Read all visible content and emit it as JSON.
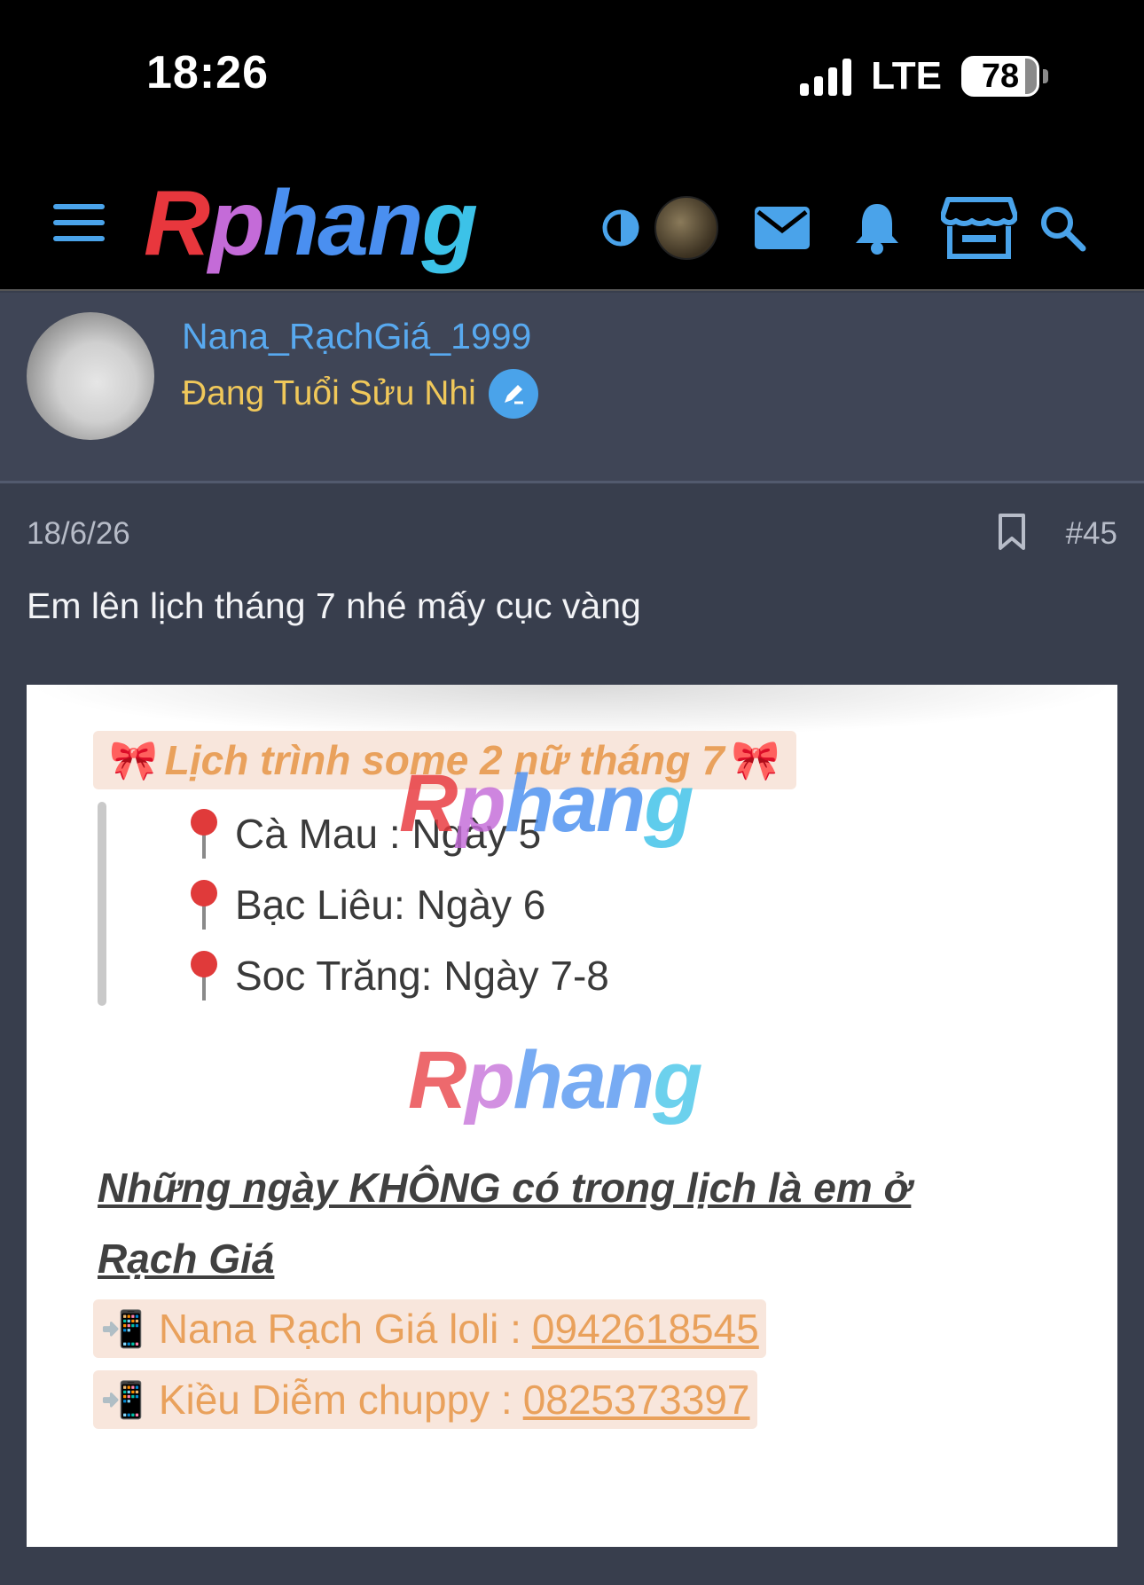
{
  "status_bar": {
    "time": "18:26",
    "network": "LTE",
    "battery": "78"
  },
  "nav": {
    "logo": {
      "a": "R",
      "b": "p",
      "c": "han",
      "d": "g"
    },
    "icons": [
      "menu-icon",
      "contrast-icon",
      "avatar",
      "mail-icon",
      "bell-icon",
      "store-icon",
      "search-icon"
    ]
  },
  "user": {
    "name": "Nana_RạchGiá_1999",
    "title": "Đang Tuổi Sửu Nhi"
  },
  "post": {
    "date": "18/6/26",
    "number": "#45",
    "text": "Em lên lịch tháng 7 nhé mấy cục vàng"
  },
  "image": {
    "title": "Lịch trình some 2 nữ tháng 7",
    "watermark": {
      "a": "R",
      "b": "p",
      "c": "han",
      "d": "g"
    },
    "locations": [
      "Cà Mau : Ngày 5",
      " Bạc Liêu: Ngày 6",
      "Soc Trăng: Ngày 7-8"
    ],
    "notice_line1": "Những ngày KHÔNG có trong lịch là em ở",
    "notice_line2": "Rạch Giá",
    "contacts": [
      {
        "label": "Nana Rạch Giá loli :",
        "number": "0942618545"
      },
      {
        "label": "Kiều Diễm chuppy :",
        "number": "0825373397"
      }
    ]
  },
  "colors": {
    "accent": "#4aa3ea",
    "username": "#58a9ef",
    "title": "#f0c85a",
    "background": "#383e4d"
  }
}
